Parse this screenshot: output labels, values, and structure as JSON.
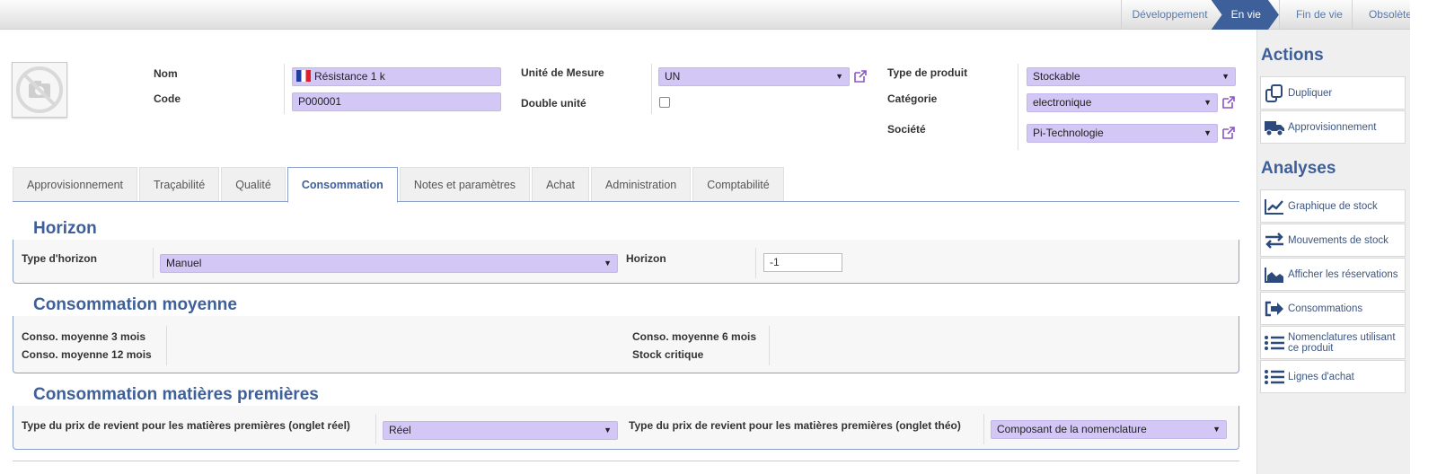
{
  "statusbar": {
    "stages": [
      "Développement",
      "En vie",
      "Fin de vie",
      "Obsolète"
    ],
    "active": "En vie"
  },
  "product": {
    "name_label": "Nom",
    "name_value": "Résistance 1 k",
    "code_label": "Code",
    "code_value": "P000001",
    "uom_label": "Unité de Mesure",
    "uom_value": "UN",
    "double_unit_label": "Double unité",
    "type_label": "Type de produit",
    "type_value": "Stockable",
    "category_label": "Catégorie",
    "category_value": "electronique",
    "company_label": "Société",
    "company_value": "Pi-Technologie"
  },
  "tabs": [
    "Approvisionnement",
    "Traçabilité",
    "Qualité",
    "Consommation",
    "Notes et paramètres",
    "Achat",
    "Administration",
    "Comptabilité"
  ],
  "active_tab": "Consommation",
  "horizon": {
    "legend": "Horizon",
    "type_label": "Type d'horizon",
    "type_value": "Manuel",
    "horizon_label": "Horizon",
    "horizon_value": "-1"
  },
  "avg_consumption": {
    "legend": "Consommation moyenne",
    "m3_label": "Conso. moyenne 3 mois",
    "m12_label": "Conso. moyenne 12 mois",
    "m6_label": "Conso. moyenne 6 mois",
    "critical_label": "Stock critique"
  },
  "raw_materials": {
    "legend": "Consommation matières premières",
    "real_label": "Type du prix de revient pour les matières premières (onglet réel)",
    "real_value": "Réel",
    "theo_label": "Type du prix de revient pour les matières premières (onglet théo)",
    "theo_value": "Composant de la nomenclature"
  },
  "sidebar": {
    "actions_title": "Actions",
    "actions": [
      "Dupliquer",
      "Approvisionnement"
    ],
    "analyses_title": "Analyses",
    "analyses": [
      "Graphique de stock",
      "Mouvements de stock",
      "Afficher les réservations",
      "Consommations",
      "Nomenclatures utilisant ce produit",
      "Lignes d'achat"
    ]
  },
  "colors": {
    "accent": "#3d5f9a",
    "field_required": "#d2c7f5"
  }
}
